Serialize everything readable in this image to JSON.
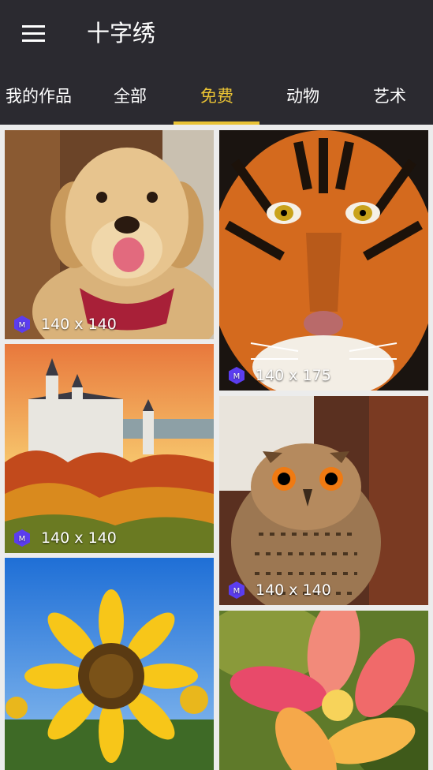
{
  "app": {
    "title": "十字绣",
    "menu_icon": "menu-icon"
  },
  "tabs": [
    {
      "label": "我的作品",
      "active": false
    },
    {
      "label": "全部",
      "active": false
    },
    {
      "label": "免费",
      "active": true
    },
    {
      "label": "动物",
      "active": false
    },
    {
      "label": "艺术",
      "active": false
    }
  ],
  "colors": {
    "appbar": "#2b2a30",
    "accent": "#e9c234",
    "badge": "#5b3df0"
  },
  "gallery": [
    {
      "subject": "golden-retriever",
      "badge_letter": "M",
      "size": "140 x 140"
    },
    {
      "subject": "tiger",
      "badge_letter": "M",
      "size": "140 x 175"
    },
    {
      "subject": "castle",
      "badge_letter": "M",
      "size": "140 x 140"
    },
    {
      "subject": "owl",
      "badge_letter": "M",
      "size": "140 x 140"
    },
    {
      "subject": "sunflower"
    },
    {
      "subject": "plumeria"
    }
  ]
}
